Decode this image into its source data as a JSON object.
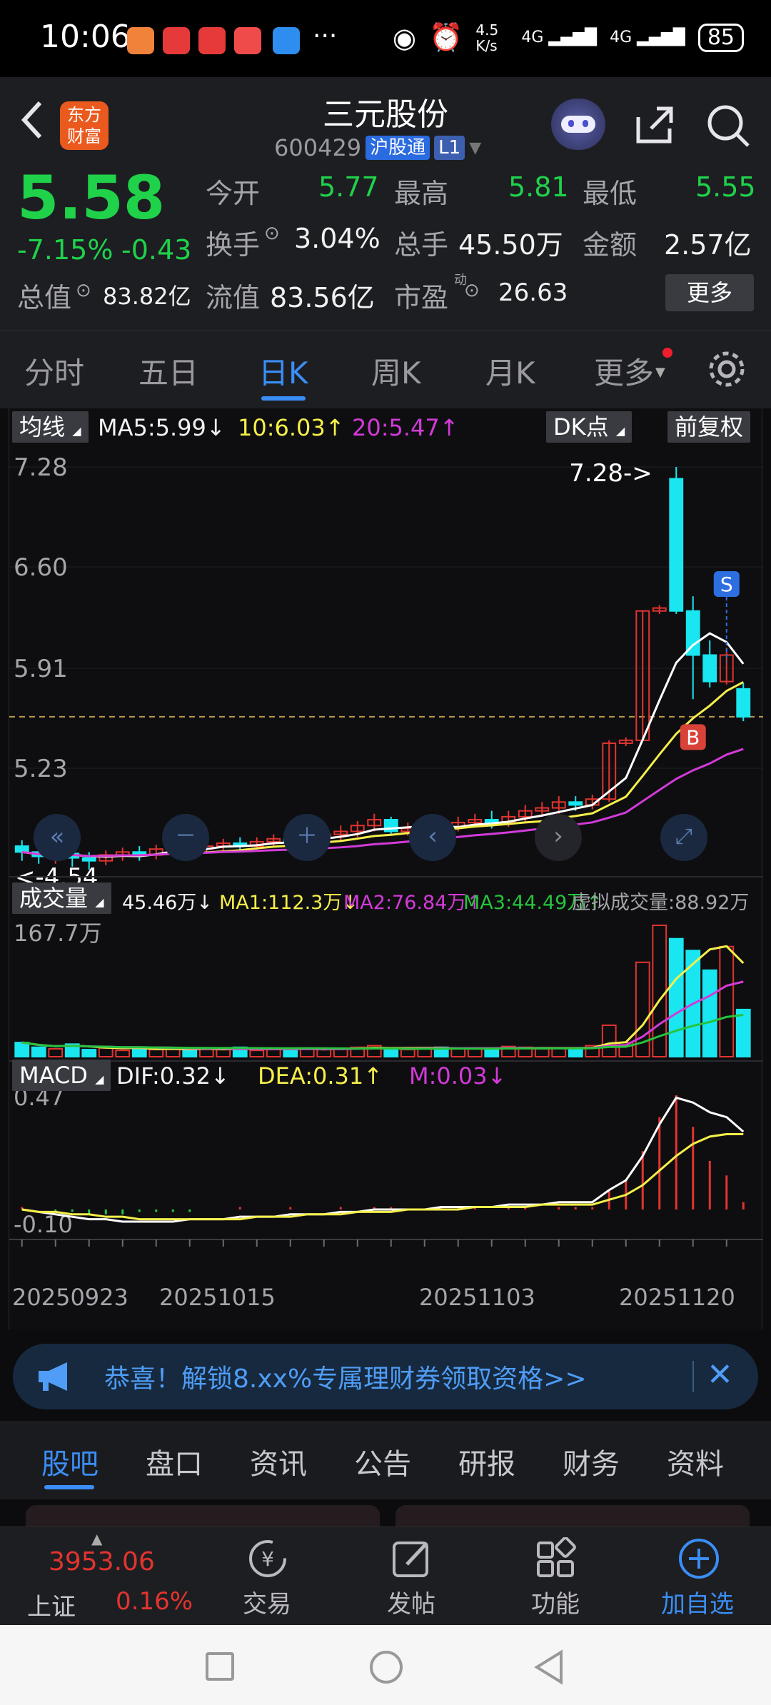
{
  "status_bar": {
    "time": "10:06",
    "network_speed": "4.5 K/s",
    "signal1": "4G",
    "signal2": "4G",
    "battery": "85"
  },
  "header": {
    "logo_line1": "东方",
    "logo_line2": "财富",
    "title": "三元股份",
    "code": "600429",
    "market_badge": "沪股通",
    "level_badge": "L1"
  },
  "quote": {
    "price": "5.58",
    "change_pct": "-7.15%",
    "change_amt": "-0.43",
    "open_label": "今开",
    "open": "5.77",
    "high_label": "最高",
    "high": "5.81",
    "low_label": "最低",
    "low": "5.55",
    "turnover_label": "换手",
    "turnover": "3.04%",
    "volume_label": "总手",
    "volume": "45.50万",
    "amount_label": "金额",
    "amount": "2.57亿",
    "mktcap_label": "总值",
    "mktcap": "83.82亿",
    "float_label": "流值",
    "float": "83.56亿",
    "pe_label": "市盈",
    "pe_sup": "动",
    "pe": "26.63",
    "more_label": "更多"
  },
  "tabs": [
    "分时",
    "五日",
    "日K",
    "周K",
    "月K",
    "更多"
  ],
  "active_tab": "日K",
  "kline": {
    "indicator_label": "均线",
    "ma5": "MA5:5.99↓",
    "ma10": "10:6.03↑",
    "ma20": "20:5.47↑",
    "dk_label": "DK点",
    "adjust_label": "前复权",
    "y_ticks": [
      "7.28",
      "6.60",
      "5.91",
      "5.23"
    ],
    "max_marker": "7.28->",
    "min_marker": "<-4.54",
    "sell_marker": "S",
    "buy_marker": "B"
  },
  "volume": {
    "label": "成交量",
    "cur": "45.46万↓",
    "ma1": "MA1:112.3万↓",
    "ma2": "MA2:76.84万↑",
    "ma3": "MA3:44.49万↑",
    "virtual": "虚拟成交量:88.92万",
    "y_tick": "167.7万"
  },
  "macd": {
    "label": "MACD",
    "dif": "DIF:0.32↓",
    "dea": "DEA:0.31↑",
    "m": "M:0.03↓",
    "y_top": "0.47",
    "y_bottom": "-0.10"
  },
  "x_dates": [
    "20250923",
    "20251015",
    "20251103",
    "20251120"
  ],
  "promo": {
    "text": "恭喜！解锁8.xx%专属理财券领取资格>>"
  },
  "subtabs": [
    "股吧",
    "盘口",
    "资讯",
    "公告",
    "研报",
    "财务",
    "资料"
  ],
  "index": {
    "value": "3953.06",
    "name": "上证",
    "change": "0.16%"
  },
  "bottom_nav": [
    "交易",
    "发帖",
    "功能",
    "加自选"
  ],
  "colors": {
    "up": "#e2342f",
    "down": "#19e6f0",
    "accent": "#3a8ef6",
    "green": "#1fd24a",
    "ma5": "#ffffff",
    "ma10": "#f5ef4a",
    "ma20": "#d33ad9"
  },
  "chart_data": {
    "type": "candlestick",
    "y_range": [
      4.54,
      7.28
    ],
    "candles": [
      {
        "o": 4.7,
        "c": 4.66,
        "h": 4.74,
        "l": 4.6
      },
      {
        "o": 4.66,
        "c": 4.63,
        "h": 4.7,
        "l": 4.58
      },
      {
        "o": 4.63,
        "c": 4.65,
        "h": 4.68,
        "l": 4.58
      },
      {
        "o": 4.65,
        "c": 4.62,
        "h": 4.68,
        "l": 4.56
      },
      {
        "o": 4.62,
        "c": 4.6,
        "h": 4.66,
        "l": 4.54
      },
      {
        "o": 4.6,
        "c": 4.64,
        "h": 4.67,
        "l": 4.57
      },
      {
        "o": 4.64,
        "c": 4.66,
        "h": 4.69,
        "l": 4.6
      },
      {
        "o": 4.66,
        "c": 4.64,
        "h": 4.7,
        "l": 4.6
      },
      {
        "o": 4.64,
        "c": 4.68,
        "h": 4.71,
        "l": 4.61
      },
      {
        "o": 4.68,
        "c": 4.7,
        "h": 4.73,
        "l": 4.64
      },
      {
        "o": 4.7,
        "c": 4.68,
        "h": 4.74,
        "l": 4.65
      },
      {
        "o": 4.68,
        "c": 4.7,
        "h": 4.73,
        "l": 4.65
      },
      {
        "o": 4.7,
        "c": 4.72,
        "h": 4.75,
        "l": 4.66
      },
      {
        "o": 4.72,
        "c": 4.7,
        "h": 4.76,
        "l": 4.67
      },
      {
        "o": 4.7,
        "c": 4.73,
        "h": 4.76,
        "l": 4.67
      },
      {
        "o": 4.73,
        "c": 4.75,
        "h": 4.78,
        "l": 4.7
      },
      {
        "o": 4.75,
        "c": 4.73,
        "h": 4.79,
        "l": 4.7
      },
      {
        "o": 4.73,
        "c": 4.76,
        "h": 4.8,
        "l": 4.7
      },
      {
        "o": 4.76,
        "c": 4.78,
        "h": 4.82,
        "l": 4.72
      },
      {
        "o": 4.78,
        "c": 4.8,
        "h": 4.84,
        "l": 4.74
      },
      {
        "o": 4.8,
        "c": 4.84,
        "h": 4.87,
        "l": 4.76
      },
      {
        "o": 4.84,
        "c": 4.88,
        "h": 4.92,
        "l": 4.8
      },
      {
        "o": 4.88,
        "c": 4.8,
        "h": 4.9,
        "l": 4.78
      },
      {
        "o": 4.8,
        "c": 4.82,
        "h": 4.86,
        "l": 4.77
      },
      {
        "o": 4.82,
        "c": 4.84,
        "h": 4.88,
        "l": 4.79
      },
      {
        "o": 4.84,
        "c": 4.83,
        "h": 4.88,
        "l": 4.8
      },
      {
        "o": 4.83,
        "c": 4.86,
        "h": 4.9,
        "l": 4.8
      },
      {
        "o": 4.86,
        "c": 4.88,
        "h": 4.92,
        "l": 4.83
      },
      {
        "o": 4.88,
        "c": 4.86,
        "h": 4.94,
        "l": 4.82
      },
      {
        "o": 4.86,
        "c": 4.9,
        "h": 4.94,
        "l": 4.83
      },
      {
        "o": 4.9,
        "c": 4.94,
        "h": 4.98,
        "l": 4.86
      },
      {
        "o": 4.94,
        "c": 4.96,
        "h": 5.0,
        "l": 4.9
      },
      {
        "o": 4.96,
        "c": 5.0,
        "h": 5.04,
        "l": 4.92
      },
      {
        "o": 5.0,
        "c": 4.98,
        "h": 5.04,
        "l": 4.94
      },
      {
        "o": 4.98,
        "c": 5.02,
        "h": 5.05,
        "l": 4.95
      },
      {
        "o": 5.02,
        "c": 5.4,
        "h": 5.42,
        "l": 5.0
      },
      {
        "o": 5.4,
        "c": 5.42,
        "h": 5.44,
        "l": 5.38
      },
      {
        "o": 5.42,
        "c": 6.3,
        "h": 6.3,
        "l": 5.42
      },
      {
        "o": 6.3,
        "c": 6.32,
        "h": 6.34,
        "l": 6.28
      },
      {
        "o": 7.2,
        "c": 6.3,
        "h": 7.28,
        "l": 6.28
      },
      {
        "o": 6.3,
        "c": 6.0,
        "h": 6.4,
        "l": 5.7
      },
      {
        "o": 6.0,
        "c": 5.82,
        "h": 6.1,
        "l": 5.78
      },
      {
        "o": 5.82,
        "c": 6.0,
        "h": 6.05,
        "l": 5.8
      },
      {
        "o": 5.77,
        "c": 5.58,
        "h": 5.81,
        "l": 5.55
      }
    ],
    "volumes": [
      18,
      12,
      10,
      16,
      9,
      11,
      8,
      12,
      9,
      10,
      8,
      11,
      9,
      12,
      8,
      9,
      10,
      11,
      9,
      10,
      12,
      14,
      10,
      9,
      11,
      12,
      10,
      11,
      9,
      13,
      12,
      10,
      11,
      9,
      14,
      40,
      18,
      120,
      167,
      150,
      135,
      110,
      140,
      60
    ],
    "macd_dif": [
      0.0,
      -0.01,
      -0.02,
      -0.03,
      -0.04,
      -0.04,
      -0.05,
      -0.05,
      -0.05,
      -0.05,
      -0.04,
      -0.04,
      -0.04,
      -0.03,
      -0.03,
      -0.03,
      -0.02,
      -0.02,
      -0.02,
      -0.01,
      -0.01,
      0.0,
      0.0,
      0.0,
      0.0,
      0.01,
      0.01,
      0.01,
      0.01,
      0.02,
      0.02,
      0.02,
      0.03,
      0.03,
      0.03,
      0.08,
      0.12,
      0.22,
      0.35,
      0.46,
      0.44,
      0.4,
      0.38,
      0.32
    ],
    "macd_dea": [
      0.0,
      -0.01,
      -0.01,
      -0.02,
      -0.02,
      -0.03,
      -0.03,
      -0.04,
      -0.04,
      -0.04,
      -0.04,
      -0.04,
      -0.04,
      -0.04,
      -0.03,
      -0.03,
      -0.03,
      -0.02,
      -0.02,
      -0.02,
      -0.01,
      -0.01,
      -0.01,
      0.0,
      0.0,
      0.0,
      0.0,
      0.01,
      0.01,
      0.01,
      0.01,
      0.02,
      0.02,
      0.02,
      0.02,
      0.04,
      0.06,
      0.1,
      0.16,
      0.22,
      0.27,
      0.3,
      0.31,
      0.31
    ],
    "macd_m": [
      0.01,
      0.0,
      -0.01,
      -0.01,
      -0.02,
      -0.02,
      -0.02,
      -0.01,
      -0.01,
      -0.01,
      -0.01,
      0.0,
      0.0,
      0.01,
      0.0,
      0.0,
      0.01,
      0.0,
      0.0,
      0.01,
      0.0,
      0.01,
      0.01,
      0.0,
      0.0,
      0.01,
      0.01,
      0.01,
      0.0,
      0.01,
      0.01,
      0.0,
      0.01,
      0.01,
      0.01,
      0.08,
      0.12,
      0.24,
      0.38,
      0.47,
      0.34,
      0.2,
      0.14,
      0.03
    ]
  }
}
